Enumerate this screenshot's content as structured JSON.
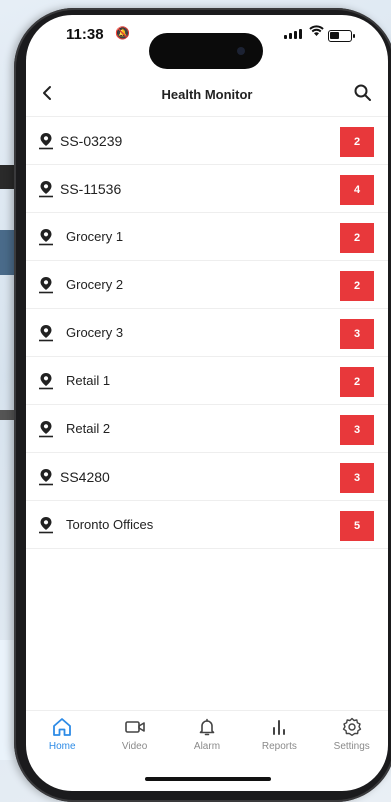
{
  "status_bar": {
    "time": "11:38"
  },
  "header": {
    "title": "Health Monitor"
  },
  "sites": [
    {
      "name": "SS-03239",
      "count": "2"
    },
    {
      "name": "SS-11536",
      "count": "4"
    },
    {
      "name": "Grocery 1",
      "count": "2"
    },
    {
      "name": "Grocery 2",
      "count": "2"
    },
    {
      "name": "Grocery 3",
      "count": "3"
    },
    {
      "name": "Retail 1",
      "count": "2"
    },
    {
      "name": "Retail 2",
      "count": "3"
    },
    {
      "name": "SS4280",
      "count": "3"
    },
    {
      "name": "Toronto Offices",
      "count": "5"
    }
  ],
  "tabs": [
    {
      "label": "Home",
      "icon": "home-icon"
    },
    {
      "label": "Video",
      "icon": "video-icon"
    },
    {
      "label": "Alarm",
      "icon": "bell-icon"
    },
    {
      "label": "Reports",
      "icon": "bar-chart-icon"
    },
    {
      "label": "Settings",
      "icon": "gear-icon"
    }
  ],
  "colors": {
    "badge": "#e8383b",
    "active_tab": "#2d8be6"
  }
}
